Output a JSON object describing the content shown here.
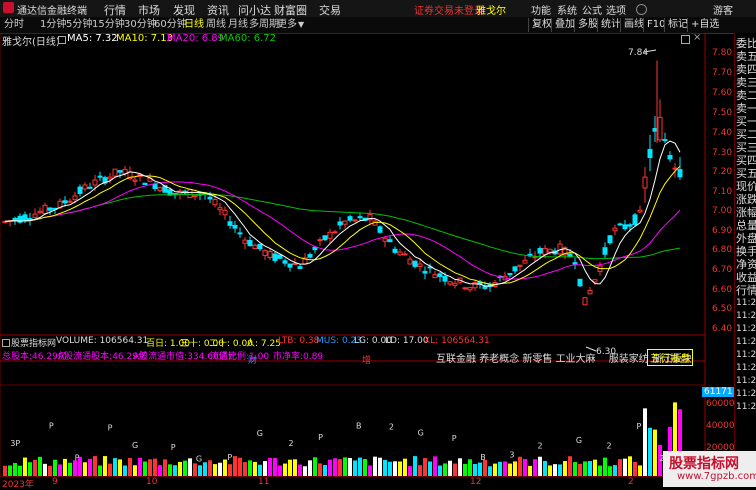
{
  "titlebar": {
    "app_name": "通达信金融终端",
    "menus": [
      "行情",
      "市场",
      "发现",
      "资讯",
      "问小达",
      "财富圈",
      "交易"
    ],
    "warning": "证券交易未登录",
    "stock": "雅戈尔",
    "right_menus": [
      "功能",
      "系统",
      "公式",
      "选项",
      "游客"
    ]
  },
  "periodbar": {
    "periods": [
      "分时",
      "1分钟",
      "5分钟",
      "15分钟",
      "30分钟",
      "60分钟",
      "日线",
      "周线",
      "月线",
      "多周期",
      "更多"
    ],
    "active_period": "日线",
    "tools": [
      "复权",
      "叠加",
      "多股",
      "统计",
      "画线",
      "F10",
      "标记",
      "+自选"
    ]
  },
  "info": {
    "name": "雅戈尔(日线)",
    "ma5": "MA5: 7.32",
    "ma10": "MA10: 7.13",
    "ma20": "MA20: 6.89",
    "ma60": "MA60: 6.72"
  },
  "colors": {
    "ma5": "#ffffff",
    "ma10": "#ffff00",
    "ma20": "#ff00ff",
    "ma60": "#00c000",
    "up": "#ff3333",
    "down": "#00e5ff",
    "axis": "#ee3333"
  },
  "annotations": {
    "high": "7.84",
    "low": "6.30",
    "marker_cai": "财",
    "marker_zeng": "增"
  },
  "price_axis": [
    "7.80",
    "7.70",
    "7.60",
    "7.50",
    "7.40",
    "7.30",
    "7.20",
    "7.10",
    "7.00",
    "6.90",
    "6.80",
    "6.70",
    "6.60",
    "6.50",
    "6.40"
  ],
  "right_panel": [
    "委比",
    "卖五",
    "卖四",
    "卖三",
    "卖二",
    "卖一",
    "买一",
    "买二",
    "买三",
    "买四",
    "买五",
    "现价",
    "涨跌",
    "涨幅",
    "总量",
    "外盘",
    "换手",
    "净资",
    "收益",
    "行情",
    "11:29",
    "11:29",
    "11:29",
    "11:29",
    "11:29",
    "11:29",
    "11:29",
    "11:29",
    "11:29"
  ],
  "volume": {
    "label": "股票指标网",
    "volume": "VOLUME: 106564.31",
    "bai": "百日: 1.00",
    "san": "三十: 0.00",
    "er": "二十: 0.00",
    "ren": "人: 7.25",
    "ltb": "LTB: 0.38",
    "mus": "MUS: 0.23",
    "lg": "LG: 0.00",
    "ld": "LD: 17.00",
    "xl": "XL: 106564.31",
    "axis": [
      "60000",
      "40000",
      "20000"
    ],
    "tag": "61171"
  },
  "capital": {
    "total": "总股本:46.29亿",
    "float": "A股流通股本:46.29亿",
    "market": "A股流通市值:334.66亿元",
    "ratio": "流通比例:1.00",
    "pe": "市净率:0.89"
  },
  "tags": [
    "互联金融",
    "养老概念",
    "新零售",
    "工业大麻",
    "服装家纺",
    "浙江板块"
  ],
  "tag_badge": "五行操盘",
  "dates": [
    "2023年",
    "9",
    "10",
    "11",
    "12",
    "2"
  ],
  "watermark": {
    "title": "股票指标网",
    "url": "www.7gpzb.com"
  },
  "chart_data": {
    "type": "candlestick",
    "ylim": [
      6.22,
      7.92
    ],
    "up_color": "#ff3333",
    "down_color": "#00e5ff",
    "high_label": 7.84,
    "low_label": 6.3
  }
}
